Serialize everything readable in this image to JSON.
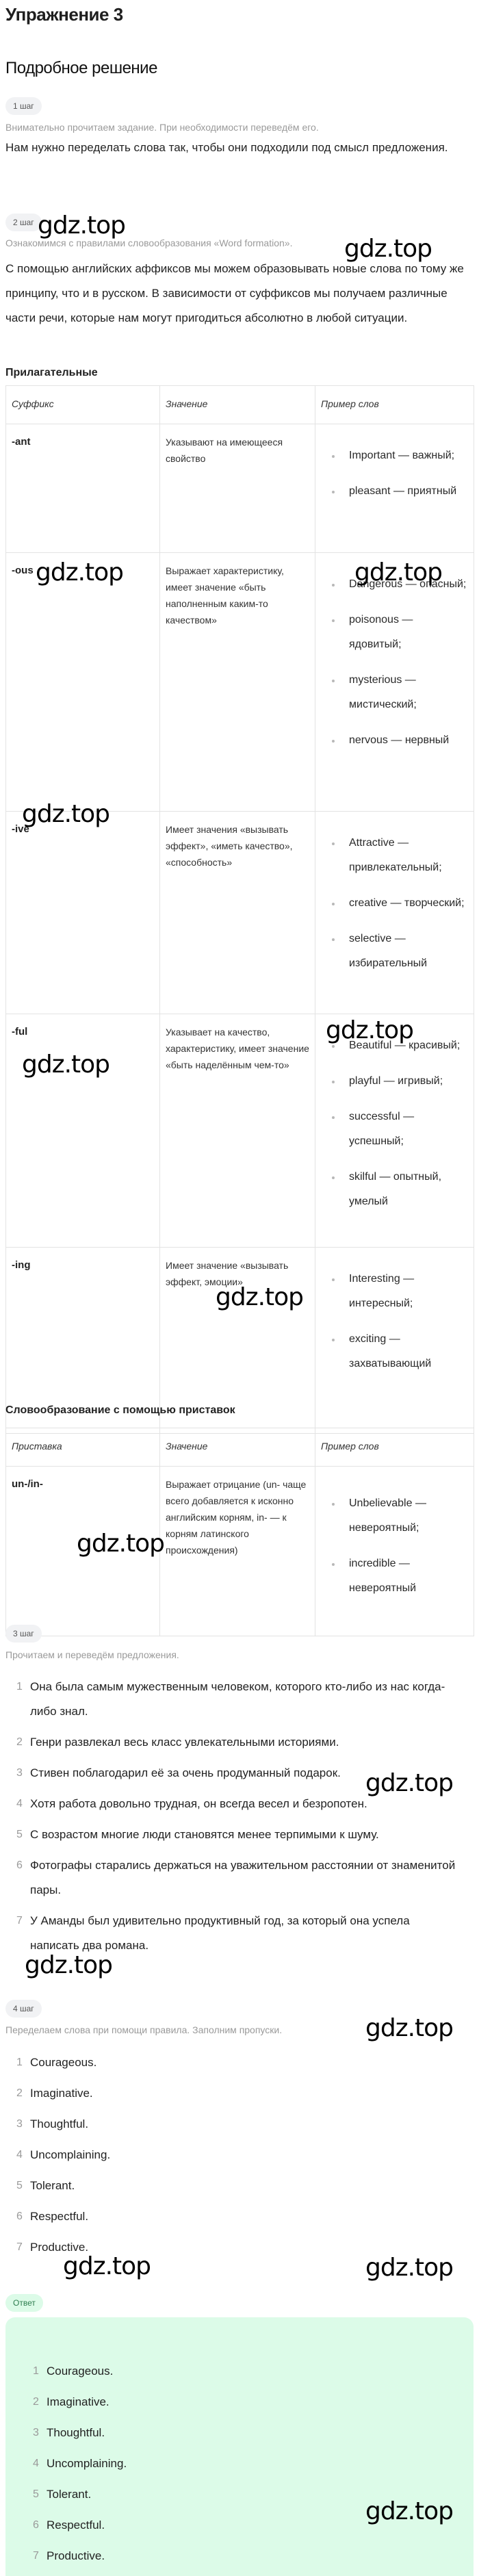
{
  "page": {
    "title": "Упражнение 3",
    "section_title": "Подробное решение"
  },
  "step1": {
    "badge": "1 шаг",
    "hint": "Внимательно прочитаем задание. При необходимости переведём его.",
    "text": "Нам нужно переделать слова так, чтобы они подходили под смысл предложения."
  },
  "step2": {
    "badge": "2 шаг",
    "hint": "Ознакомимся с правилами словообразования «Word formation».",
    "text": "С помощью английских аффиксов мы можем образовывать новые слова по тому же принципу, что и в русском. В зависимости от суффиксов мы получаем различные части речи, которые нам могут пригодиться абсолютно в любой ситуации.",
    "adjectives_heading": "Прилагательные",
    "suffix_table": {
      "headers": [
        "Суффикс",
        "Значение",
        "Пример слов"
      ],
      "rows": [
        {
          "affix": "-ant",
          "meaning": "Указывают на имеющееся свойство",
          "examples": [
            "Important — важный;",
            "pleasant — приятный"
          ]
        },
        {
          "affix": "-ous",
          "meaning": "Выражает характеристику, имеет значение «быть наполненным каким-то качеством»",
          "examples": [
            "Dangerous — опасный;",
            "poisonous — ядовитый;",
            "mysterious — мистический;",
            "nervous — нервный"
          ]
        },
        {
          "affix": "-ive",
          "meaning": "Имеет значения «вызывать эффект», «иметь качество», «способность»",
          "examples": [
            "Attractive — привлекательный;",
            "creative — творческий;",
            "selective — избирательный"
          ]
        },
        {
          "affix": "-ful",
          "meaning": "Указывает на качество, характеристику, имеет значение «быть наделённым чем-то»",
          "examples": [
            "Beautiful — красивый;",
            "playful — игривый;",
            "successful — успешный;",
            "skilful — опытный, умелый"
          ]
        },
        {
          "affix": "-ing",
          "meaning": "Имеет значение «вызывать эффект, эмоции»",
          "examples": [
            "Interesting — интересный;",
            "exciting — захватывающий"
          ]
        }
      ]
    },
    "prefix_heading": "Словообразование с помощью приставок",
    "prefix_table": {
      "headers": [
        "Приставка",
        "Значение",
        "Пример слов"
      ],
      "rows": [
        {
          "affix": "un-/in-",
          "meaning": "Выражает отрицание (un- чаще всего добавляется к исконно английским корням, in- — к корням латинского происхождения)",
          "examples": [
            "Unbelievable — невероятный;",
            "incredible — невероятный"
          ]
        }
      ]
    }
  },
  "step3": {
    "badge": "3 шаг",
    "hint": "Прочитаем и переведём предложения.",
    "sentences": [
      {
        "num": "1",
        "text": "Она была самым мужественным человеком, которого кто-либо из нас когда-либо знал."
      },
      {
        "num": "2",
        "text": "Генри развлекал весь класс увлекательными историями."
      },
      {
        "num": "3",
        "text": "Стивен поблагодарил её за очень продуманный подарок."
      },
      {
        "num": "4",
        "text": "Хотя работа довольно трудная, он всегда весел и безропотен."
      },
      {
        "num": "5",
        "text": "С возрастом многие люди становятся менее терпимыми к шуму."
      },
      {
        "num": "6",
        "text": "Фотографы старались держаться на уважительном расстоянии от знаменитой пары."
      },
      {
        "num": "7",
        "text": "У Аманды был удивительно продуктивный год, за который она успела написать два романа."
      }
    ]
  },
  "step4": {
    "badge": "4 шаг",
    "hint": "Переделаем слова при помощи правила. Заполним пропуски.",
    "answers": [
      {
        "num": "1",
        "text": "Courageous."
      },
      {
        "num": "2",
        "text": "Imaginative."
      },
      {
        "num": "3",
        "text": "Thoughtful."
      },
      {
        "num": "4",
        "text": "Uncomplaining."
      },
      {
        "num": "5",
        "text": "Tolerant."
      },
      {
        "num": "6",
        "text": "Respectful."
      },
      {
        "num": "7",
        "text": "Productive."
      }
    ]
  },
  "answer": {
    "badge": "Ответ",
    "items": [
      {
        "num": "1",
        "text": "Courageous."
      },
      {
        "num": "2",
        "text": "Imaginative."
      },
      {
        "num": "3",
        "text": "Thoughtful."
      },
      {
        "num": "4",
        "text": "Uncomplaining."
      },
      {
        "num": "5",
        "text": "Tolerant."
      },
      {
        "num": "6",
        "text": "Respectful."
      },
      {
        "num": "7",
        "text": "Productive."
      }
    ]
  },
  "watermark": {
    "text": "gdz.top"
  },
  "colors": {
    "answer_background": "#dcfbe8",
    "answer_badge_text": "#2e7d4f",
    "step_badge_background": "#f1f2f4",
    "hint_text": "#9a9a9a"
  }
}
